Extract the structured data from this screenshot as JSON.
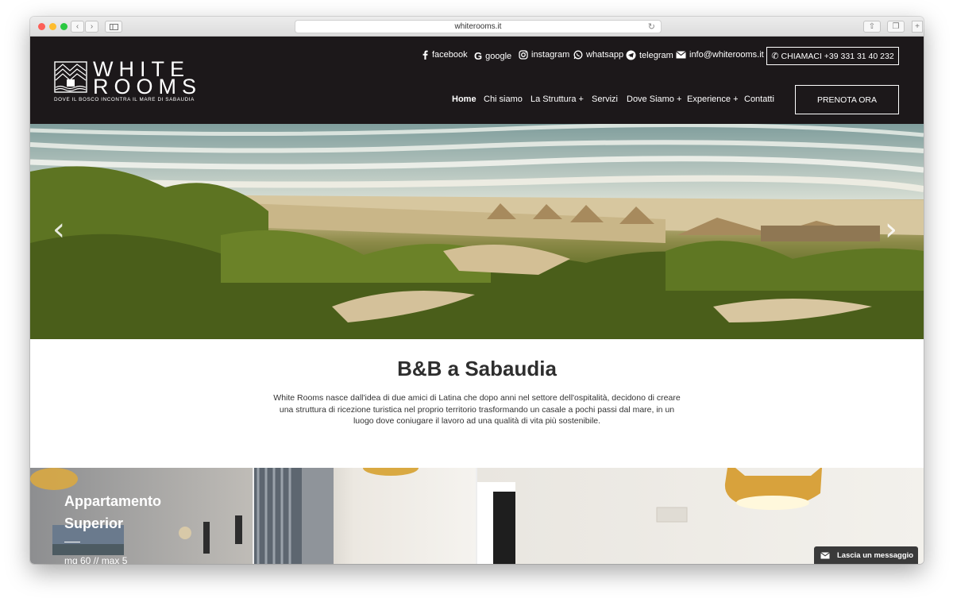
{
  "browser": {
    "url": "whiterooms.it"
  },
  "logo": {
    "line1": "WHITE",
    "line2": "ROOMS",
    "tagline": "DOVE IL BOSCO INCONTRA IL MARE DI SABAUDIA"
  },
  "social": {
    "facebook": "facebook",
    "google": "google",
    "instagram": "instagram",
    "whatsapp": "whatsapp",
    "telegram": "telegram",
    "email": "info@whiterooms.it"
  },
  "call": {
    "label": "CHIAMACI +39 331 31 40 232"
  },
  "menu": {
    "home": "Home",
    "chi_siamo": "Chi siamo",
    "struttura": "La Struttura +",
    "servizi": "Servizi",
    "dove_siamo": "Dove Siamo +",
    "experience": "Experience +",
    "contatti": "Contatti"
  },
  "book": {
    "label": "PRENOTA ORA"
  },
  "intro": {
    "title": "B&B a Sabaudia",
    "text": "White Rooms nasce dall'idea di due amici di Latina che dopo anni nel settore dell'ospitalità, decidono di creare una struttura di ricezione turistica nel proprio territorio trasformando un casale a pochi passi dal mare, in un luogo dove coniugare il lavoro ad una qualità di vita più sostenibile."
  },
  "rooms": {
    "first_title_l1": "Appartamento",
    "first_title_l2": "Superior",
    "first_meta": "mq 60 // max 5"
  },
  "chat": {
    "label": "Lascia un messaggio"
  },
  "colors": {
    "header_bg": "#1c181a",
    "text_dark": "#2e2e2e"
  }
}
